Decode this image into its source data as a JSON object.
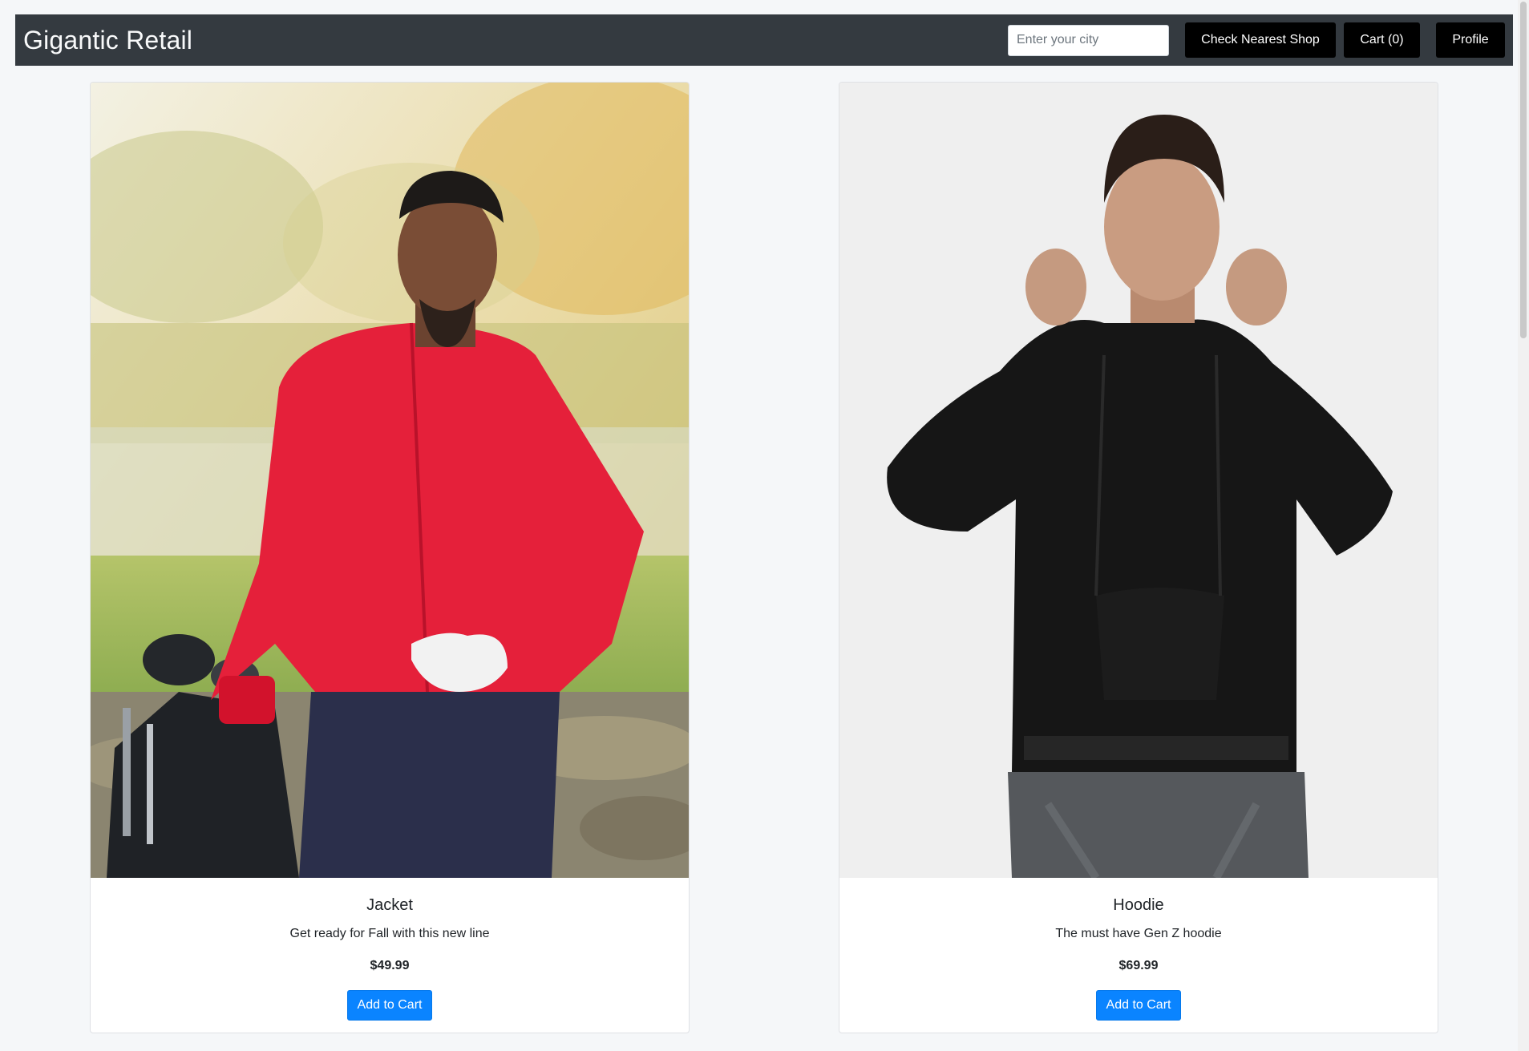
{
  "header": {
    "brand": "Gigantic Retail",
    "city_placeholder": "Enter your city",
    "check_shop_label": "Check Nearest Shop",
    "cart_label": "Cart (0)",
    "profile_label": "Profile"
  },
  "products": [
    {
      "name": "Jacket",
      "description": "Get ready for Fall with this new line",
      "price": "$49.99",
      "button_label": "Add to Cart"
    },
    {
      "name": "Hoodie",
      "description": "The must have Gen Z hoodie",
      "price": "$69.99",
      "button_label": "Add to Cart"
    }
  ],
  "colors": {
    "navbar_bg": "#343a40",
    "nav_button_bg": "#000000",
    "primary_button": "#0a84ff",
    "page_bg": "#f5f7f9"
  }
}
